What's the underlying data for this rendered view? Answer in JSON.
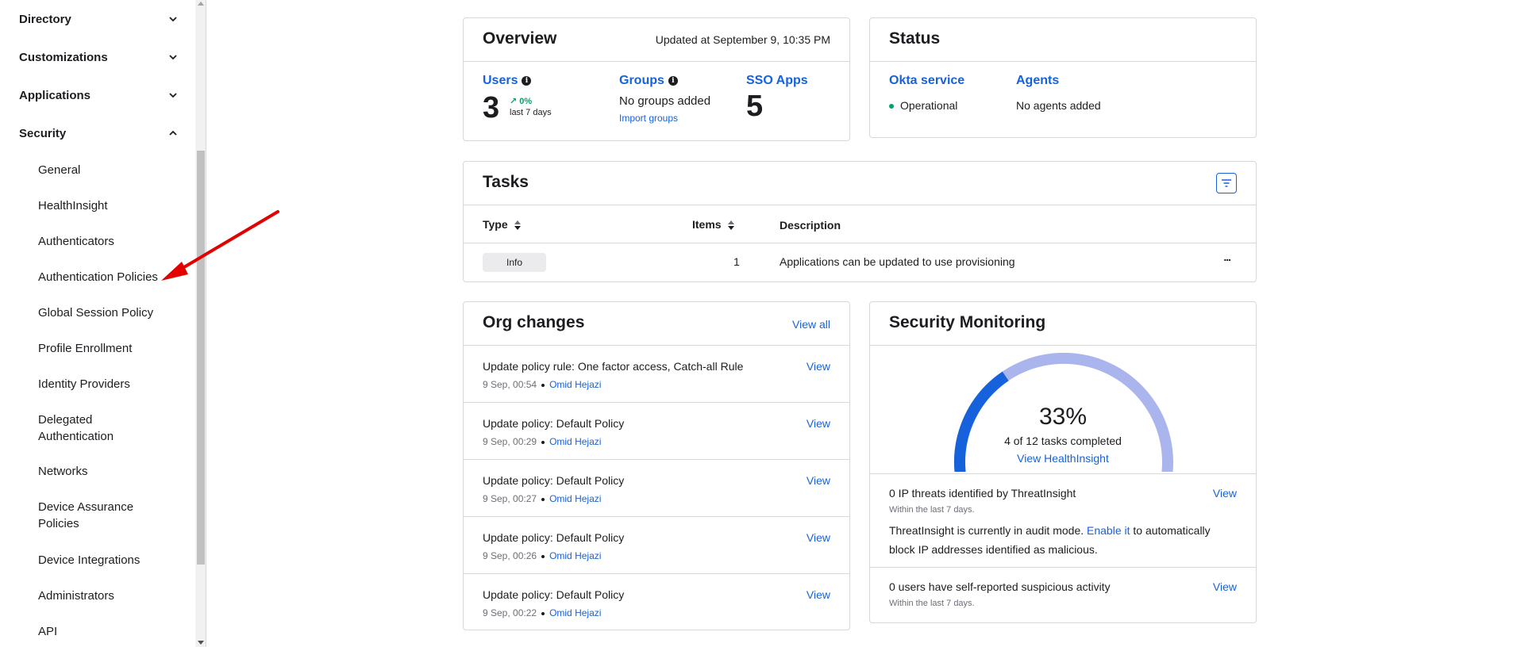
{
  "sidebar": {
    "groups": [
      {
        "label": "Directory",
        "state": "collapsed"
      },
      {
        "label": "Customizations",
        "state": "collapsed"
      },
      {
        "label": "Applications",
        "state": "collapsed"
      },
      {
        "label": "Security",
        "state": "expanded"
      }
    ],
    "security_items": [
      "General",
      "HealthInsight",
      "Authenticators",
      "Authentication Policies",
      "Global Session Policy",
      "Profile Enrollment",
      "Identity Providers",
      "Delegated Authentication",
      "Networks",
      "Device Assurance Policies",
      "Device Integrations",
      "Administrators",
      "API"
    ]
  },
  "overview": {
    "title": "Overview",
    "updated": "Updated at September 9, 10:35 PM",
    "users_label": "Users",
    "users_count": "3",
    "users_change": "0%",
    "users_period": "last 7 days",
    "groups_label": "Groups",
    "groups_text": "No groups added",
    "groups_link": "Import groups",
    "sso_label": "SSO Apps",
    "sso_count": "5"
  },
  "status": {
    "title": "Status",
    "okta_label": "Okta service",
    "okta_state": "Operational",
    "agents_label": "Agents",
    "agents_state": "No agents added"
  },
  "tasks": {
    "title": "Tasks",
    "headers": {
      "type": "Type",
      "items": "Items",
      "description": "Description"
    },
    "rows": [
      {
        "type": "Info",
        "items": "1",
        "description": "Applications can be updated to use provisioning",
        "more": "..."
      }
    ]
  },
  "org_changes": {
    "title": "Org changes",
    "view_all": "View all",
    "rows": [
      {
        "title": "Update policy rule: One factor access, Catch-all Rule",
        "time": "9 Sep, 00:54",
        "user": "Omid Hejazi",
        "action": "View"
      },
      {
        "title": "Update policy: Default Policy",
        "time": "9 Sep, 00:29",
        "user": "Omid Hejazi",
        "action": "View"
      },
      {
        "title": "Update policy: Default Policy",
        "time": "9 Sep, 00:27",
        "user": "Omid Hejazi",
        "action": "View"
      },
      {
        "title": "Update policy: Default Policy",
        "time": "9 Sep, 00:26",
        "user": "Omid Hejazi",
        "action": "View"
      },
      {
        "title": "Update policy: Default Policy",
        "time": "9 Sep, 00:22",
        "user": "Omid Hejazi",
        "action": "View"
      }
    ]
  },
  "security_monitoring": {
    "title": "Security Monitoring",
    "percent": "33%",
    "progress": 0.33,
    "tasks_completed": "4 of 12 tasks completed",
    "view_link": "View HealthInsight",
    "threats_title": "0 IP threats identified by ThreatInsight",
    "threats_period": "Within the last 7 days.",
    "threats_view": "View",
    "audit_text_1": "ThreatInsight is currently in audit mode.",
    "audit_link": "Enable it",
    "audit_text_2": "to automatically block IP addresses identified as malicious.",
    "suspicious_title": "0 users have self-reported suspicious activity",
    "suspicious_period": "Within the last 7 days.",
    "suspicious_view": "View"
  },
  "colors": {
    "accent": "#1662dd",
    "gauge_track": "#aab5ee",
    "positive": "#00a36c",
    "arrow": "#e30000"
  }
}
